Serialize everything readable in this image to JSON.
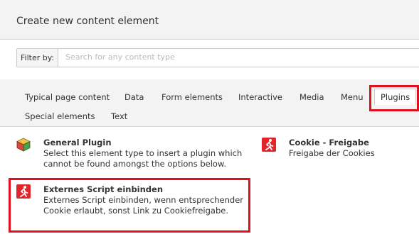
{
  "dialog": {
    "title": "Create new content element"
  },
  "filter": {
    "label": "Filter by:",
    "placeholder": "Search for any content type",
    "value": ""
  },
  "tabs": [
    {
      "label": "Typical page content"
    },
    {
      "label": "Data"
    },
    {
      "label": "Form elements"
    },
    {
      "label": "Interactive"
    },
    {
      "label": "Media"
    },
    {
      "label": "Menu"
    },
    {
      "label": "Plugins",
      "active": true
    },
    {
      "label": "Special elements"
    },
    {
      "label": "Text"
    }
  ],
  "items": [
    {
      "name": "General Plugin",
      "description": [
        "Select this element type to insert a plugin which",
        "cannot be found amongst the options below."
      ],
      "icon": "plugin-box-icon"
    },
    {
      "name": "Cookie - Freigabe",
      "description": [
        "Freigabe der Cookies"
      ],
      "icon": "running-person-icon"
    },
    {
      "name": "Externes Script einbinden",
      "description": [
        "Externes Script einbinden, wenn entsprechender",
        "Cookie erlaubt, sonst Link zu Cookiefreigabe."
      ],
      "icon": "running-person-icon"
    }
  ],
  "colors": {
    "highlight": "#e0101c",
    "icon_red": "#e2242b"
  }
}
